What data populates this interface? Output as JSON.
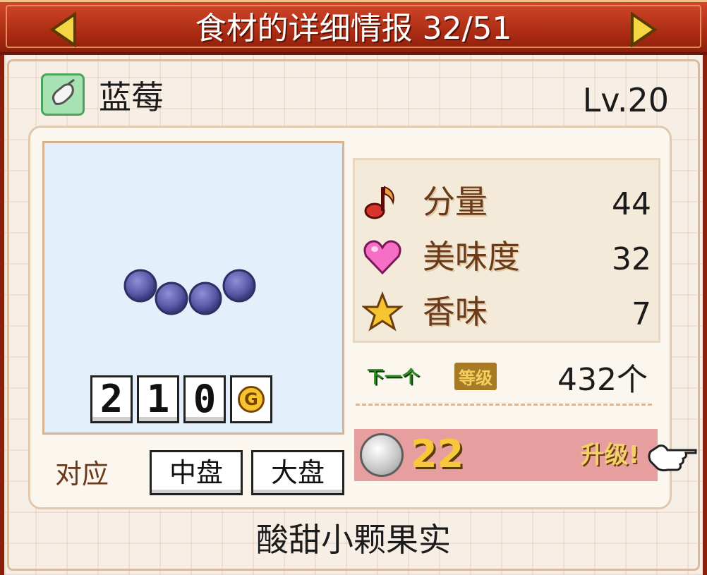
{
  "header": {
    "title": "食材的详细情报 32/51",
    "prev_icon": "triangle-left-icon",
    "next_icon": "triangle-right-icon"
  },
  "item": {
    "name": "蓝莓",
    "level": "Lv.20",
    "category_icon": "ingredient-bag-icon",
    "price_digits": [
      "2",
      "1",
      "0"
    ],
    "price_currency": "G"
  },
  "compat": {
    "label": "对应",
    "plates": [
      "中盘",
      "大盘"
    ]
  },
  "stats": [
    {
      "icon": "music-note-icon",
      "label": "分量",
      "value": "44"
    },
    {
      "icon": "heart-icon",
      "label": "美味度",
      "value": "32"
    },
    {
      "icon": "star-icon",
      "label": "香味",
      "value": "7"
    }
  ],
  "next_level": {
    "next_label": "下一个",
    "level_label": "等级",
    "count": "432个"
  },
  "upgrade": {
    "cost": "22",
    "label": "升级!",
    "coin_icon": "silver-coin-icon",
    "pointer_icon": "hand-pointer-icon"
  },
  "description": "酸甜小颗果实",
  "colors": {
    "header_red": "#b23a1a",
    "panel_bg": "#f7efe6",
    "image_bg": "#e3f0fb",
    "upgrade_bar": "#e79e9e",
    "stat_label": "#6a3a1a"
  }
}
